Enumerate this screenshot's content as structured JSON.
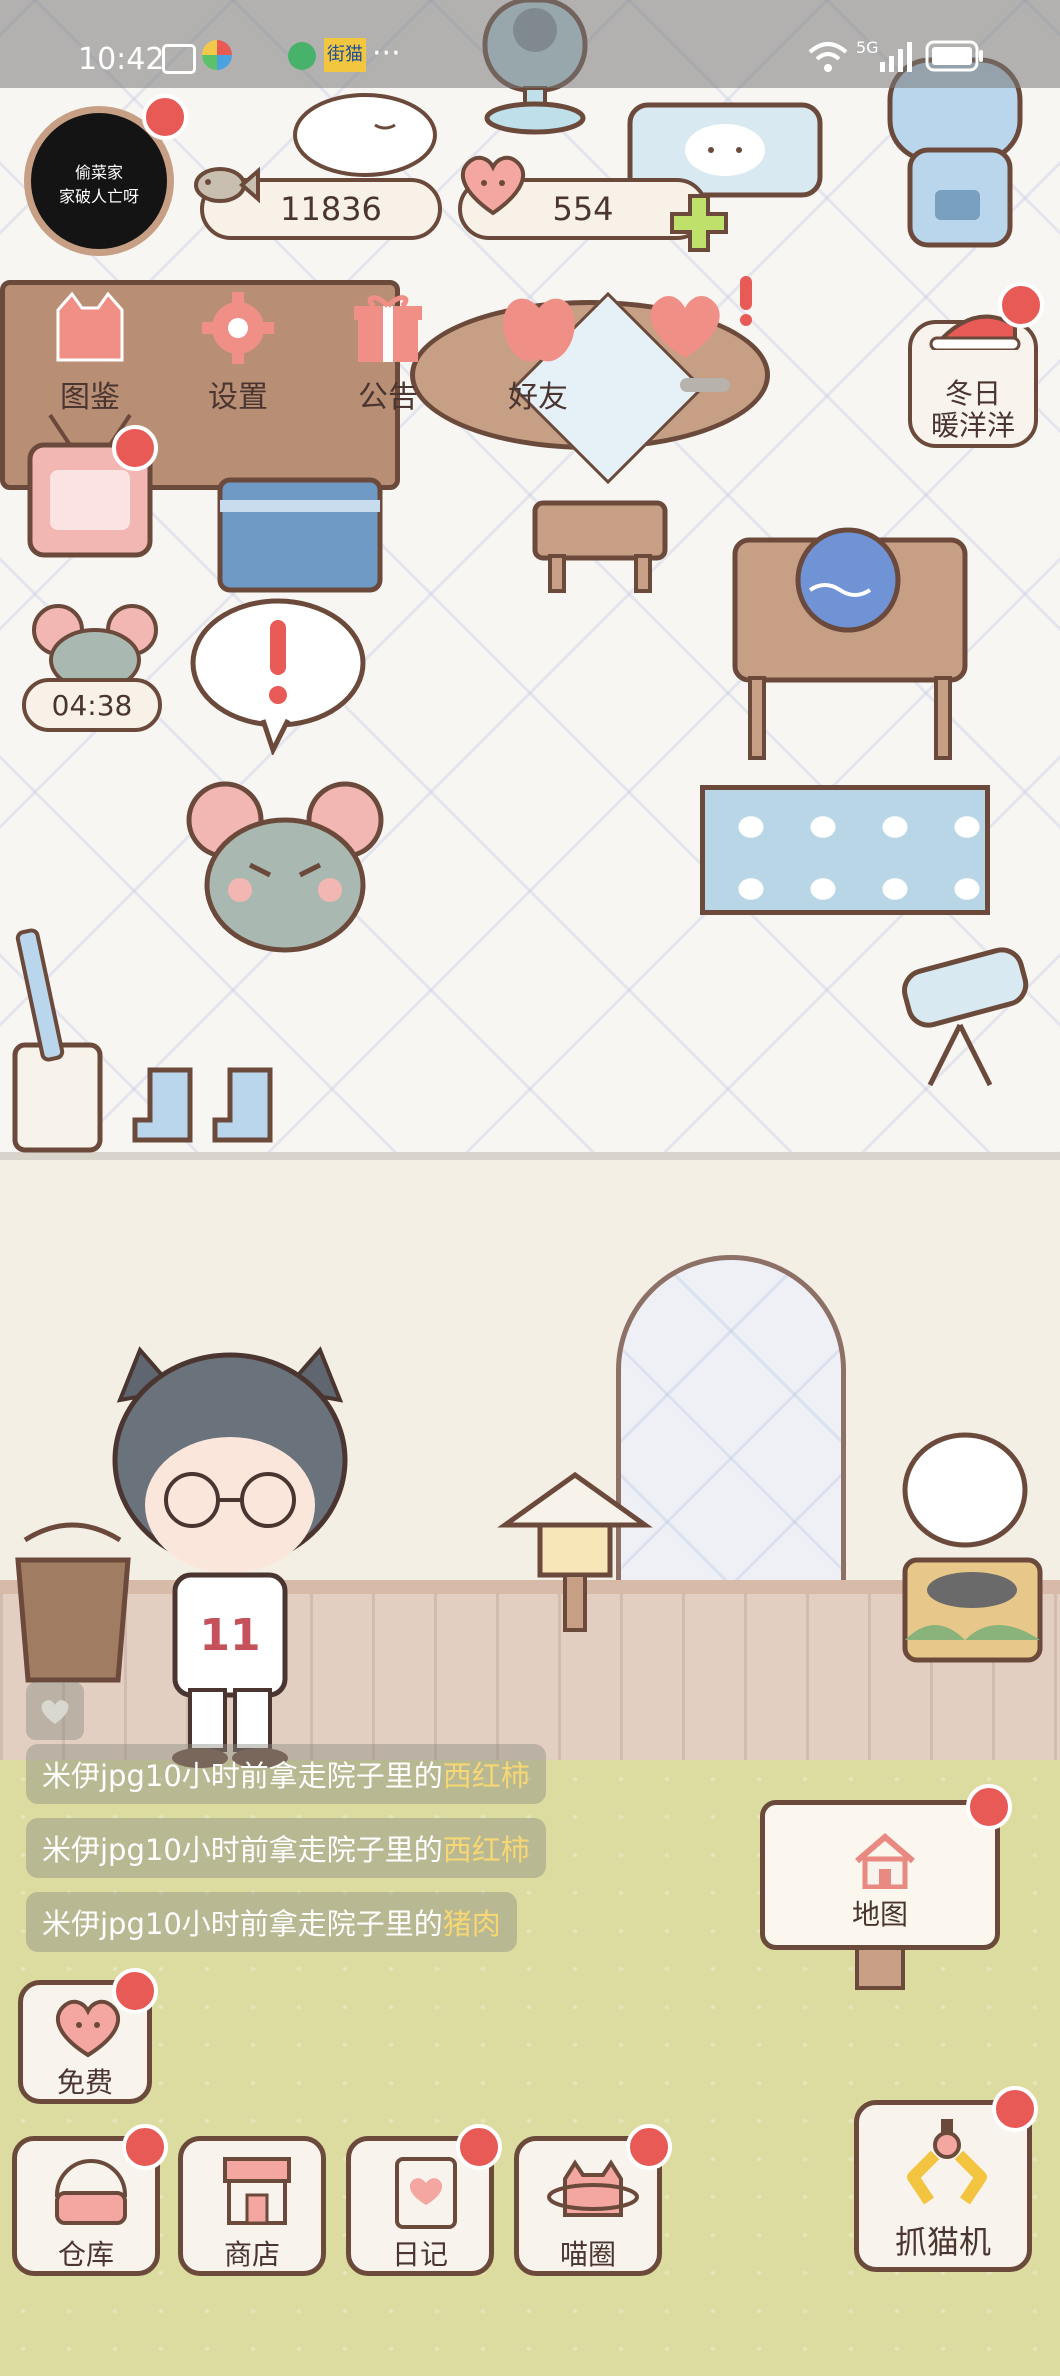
{
  "status_bar": {
    "time": "10:42",
    "notif_app_label": "街猫",
    "more": "···",
    "network": "5G"
  },
  "profile": {
    "avatar_line1": "偷菜家",
    "avatar_line2": "家破人亡呀"
  },
  "currency": {
    "fish": "11836",
    "hearts": "554"
  },
  "top_menu": [
    {
      "label": "图鉴"
    },
    {
      "label": "设置"
    },
    {
      "label": "公告"
    },
    {
      "label": "好友"
    }
  ],
  "event_badge": {
    "line1": "冬日",
    "line2": "暖洋洋"
  },
  "mouse_timer": "04:38",
  "feed": [
    {
      "prefix": "米伊jpg10小时前拿走院子里的",
      "item": "西红柿"
    },
    {
      "prefix": "米伊jpg10小时前拿走院子里的",
      "item": "西红柿"
    },
    {
      "prefix": "米伊jpg10小时前拿走院子里的",
      "item": "猪肉"
    }
  ],
  "map_sign": "地图",
  "free_button": "免费",
  "bottom_menu": [
    {
      "label": "仓库"
    },
    {
      "label": "商店"
    },
    {
      "label": "日记"
    },
    {
      "label": "喵圈"
    }
  ],
  "claw_machine": "抓猫机",
  "character": {
    "jersey_number": "11"
  },
  "colors": {
    "dot_red": "#e85a56",
    "outline_brown": "#6b4a3c",
    "highlight_yellow": "#f7d774",
    "grass": "#dcdca0"
  }
}
